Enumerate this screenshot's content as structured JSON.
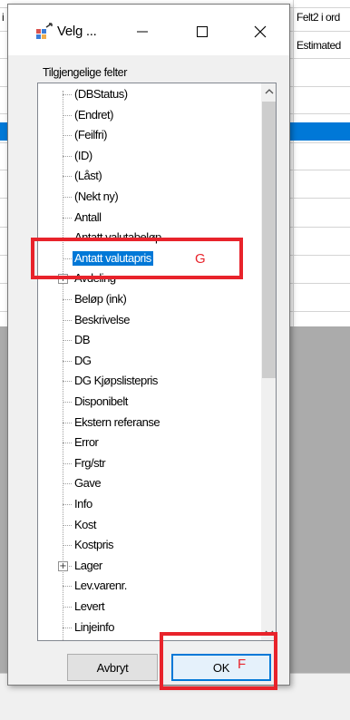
{
  "background_app": {
    "row_marker": "i",
    "column_header": "Felt2 i ord",
    "column_value": "Estimated"
  },
  "dialog": {
    "title": "Velg ...",
    "fields_label": "Tilgjengelige felter",
    "fields": [
      {
        "label": "(DBStatus)",
        "expandable": false
      },
      {
        "label": "(Endret)",
        "expandable": false
      },
      {
        "label": "(Feilfri)",
        "expandable": false
      },
      {
        "label": "(ID)",
        "expandable": false
      },
      {
        "label": "(Låst)",
        "expandable": false
      },
      {
        "label": "(Nekt ny)",
        "expandable": false
      },
      {
        "label": "Antall",
        "expandable": false
      },
      {
        "label": "Antatt valutabeløp",
        "expandable": false
      },
      {
        "label": "Antatt valutapris",
        "expandable": false,
        "selected": true
      },
      {
        "label": "Avdeling",
        "expandable": true
      },
      {
        "label": "Beløp (ink)",
        "expandable": false
      },
      {
        "label": "Beskrivelse",
        "expandable": false
      },
      {
        "label": "DB",
        "expandable": false
      },
      {
        "label": "DG",
        "expandable": false
      },
      {
        "label": "DG Kjøpslistepris",
        "expandable": false
      },
      {
        "label": "Disponibelt",
        "expandable": false
      },
      {
        "label": "Ekstern referanse",
        "expandable": false
      },
      {
        "label": "Error",
        "expandable": false
      },
      {
        "label": "Frg/str",
        "expandable": false
      },
      {
        "label": "Gave",
        "expandable": false
      },
      {
        "label": "Info",
        "expandable": false
      },
      {
        "label": "Kost",
        "expandable": false
      },
      {
        "label": "Kostpris",
        "expandable": false
      },
      {
        "label": "Lager",
        "expandable": true
      },
      {
        "label": "Lev.varenr.",
        "expandable": false
      },
      {
        "label": "Levert",
        "expandable": false
      },
      {
        "label": "Linjeinfo",
        "expandable": false
      }
    ],
    "cancel_label": "Avbryt",
    "ok_label": "OK"
  },
  "annotations": {
    "g": "G",
    "f": "F",
    "color": "#e8232b"
  },
  "colors": {
    "selection": "#0078d7",
    "dialog_bg": "#f0f0f0"
  }
}
